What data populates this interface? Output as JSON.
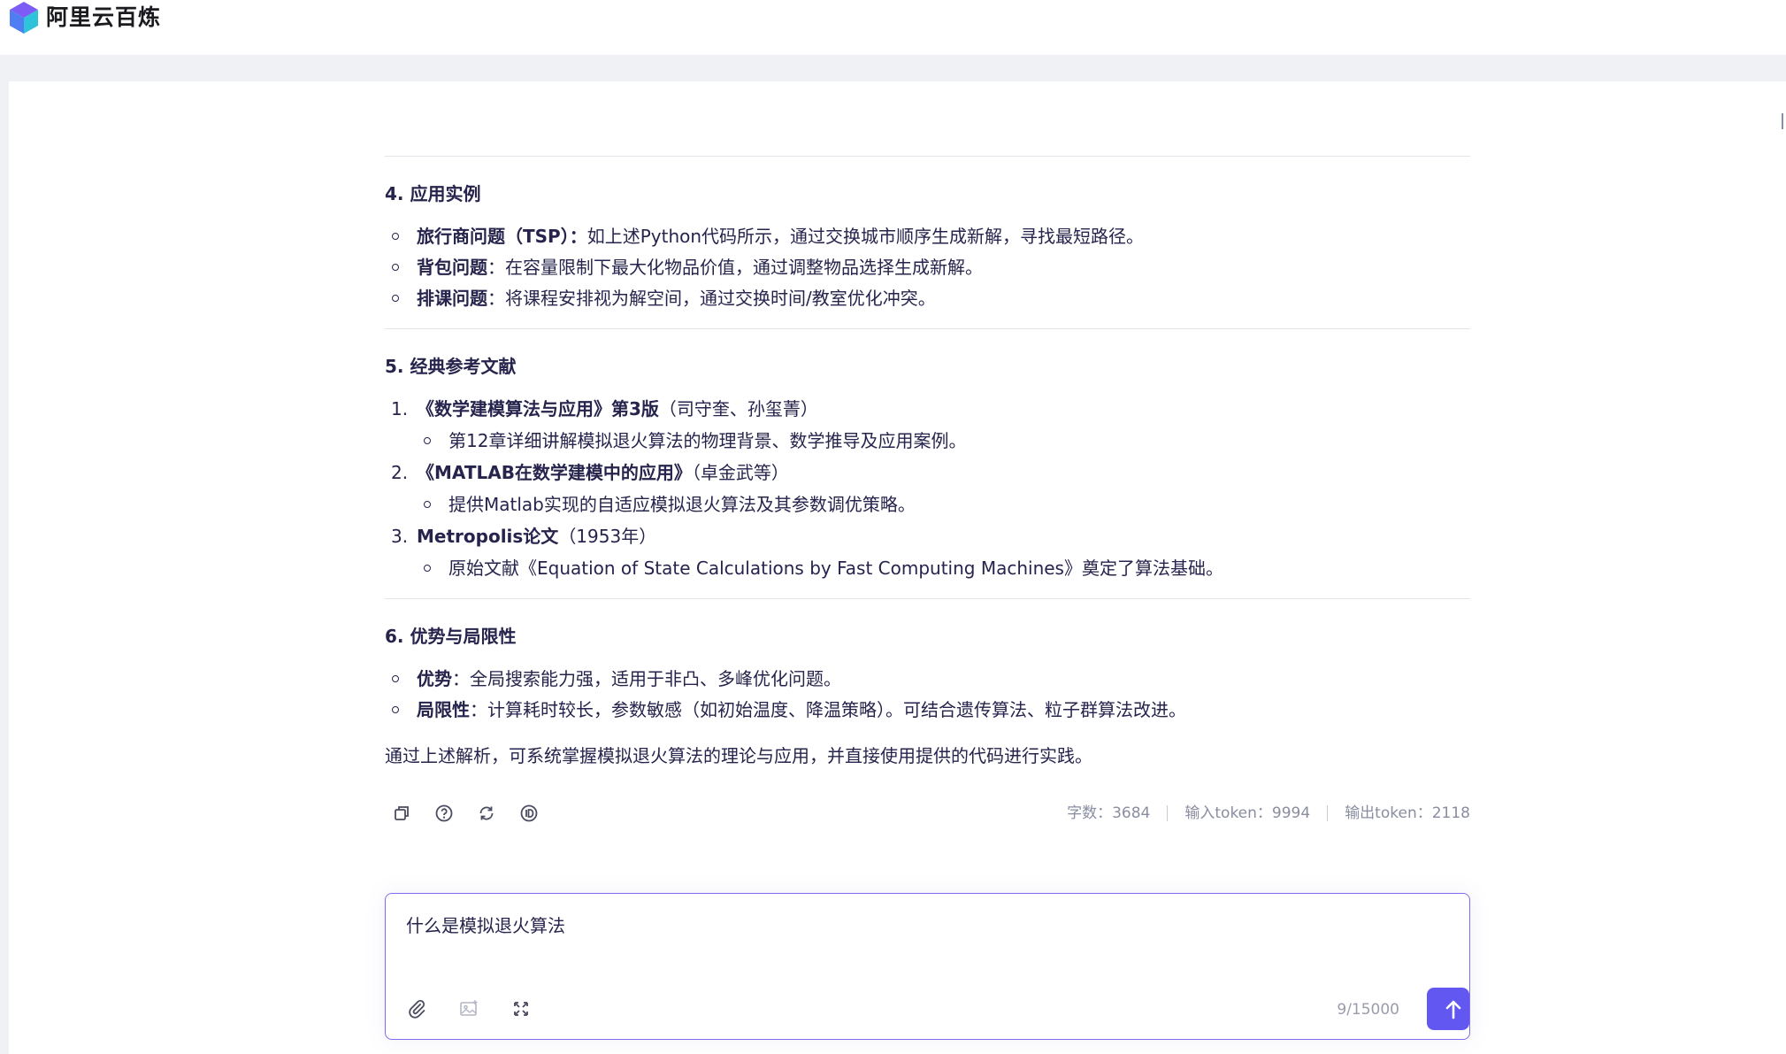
{
  "brand": {
    "name": "阿里云百炼"
  },
  "sections": {
    "s4": {
      "title": "4. 应用实例",
      "items": [
        {
          "bold": "旅行商问题（TSP）：",
          "text": "如上述Python代码所示，通过交换城市顺序生成新解，寻找最短路径。"
        },
        {
          "bold": "背包问题",
          "text": "：在容量限制下最大化物品价值，通过调整物品选择生成新解。"
        },
        {
          "bold": "排课问题",
          "text": "：将课程安排视为解空间，通过交换时间/教室优化冲突。"
        }
      ]
    },
    "s5": {
      "title": "5. 经典参考文献",
      "refs": [
        {
          "num": "1.",
          "bold": "《数学建模算法与应用》第3版",
          "text": "（司守奎、孙玺菁）",
          "sub": "第12章详细讲解模拟退火算法的物理背景、数学推导及应用案例。"
        },
        {
          "num": "2.",
          "bold": "《MATLAB在数学建模中的应用》",
          "text": "（卓金武等）",
          "sub": "提供Matlab实现的自适应模拟退火算法及其参数调优策略。"
        },
        {
          "num": "3.",
          "bold": "Metropolis论文",
          "text": "（1953年）",
          "sub": "原始文献《Equation of State Calculations by Fast Computing Machines》奠定了算法基础。"
        }
      ]
    },
    "s6": {
      "title": "6. 优势与局限性",
      "items": [
        {
          "bold": "优势",
          "text": "：全局搜索能力强，适用于非凸、多峰优化问题。"
        },
        {
          "bold": "局限性",
          "text": "：计算耗时较长，参数敏感（如初始温度、降温策略）。可结合遗传算法、粒子群算法改进。"
        }
      ]
    }
  },
  "summary": "通过上述解析，可系统掌握模拟退火算法的理论与应用，并直接使用提供的代码进行实践。",
  "stats": {
    "chars": "字数：3684",
    "input_tokens": "输入token：9994",
    "output_tokens": "输出token：2118"
  },
  "composer": {
    "value": "什么是模拟退火算法",
    "counter": "9/15000"
  },
  "icons": {
    "actions": [
      "copy-icon",
      "help-icon",
      "regenerate-icon",
      "id-icon"
    ],
    "tools": [
      "attach-icon",
      "image-icon",
      "expand-icon"
    ],
    "send": "arrow-up-icon"
  },
  "colors": {
    "accent": "#6257f0",
    "border": "#7b6cf2",
    "text": "#26244c",
    "muted": "#8a8da0"
  }
}
